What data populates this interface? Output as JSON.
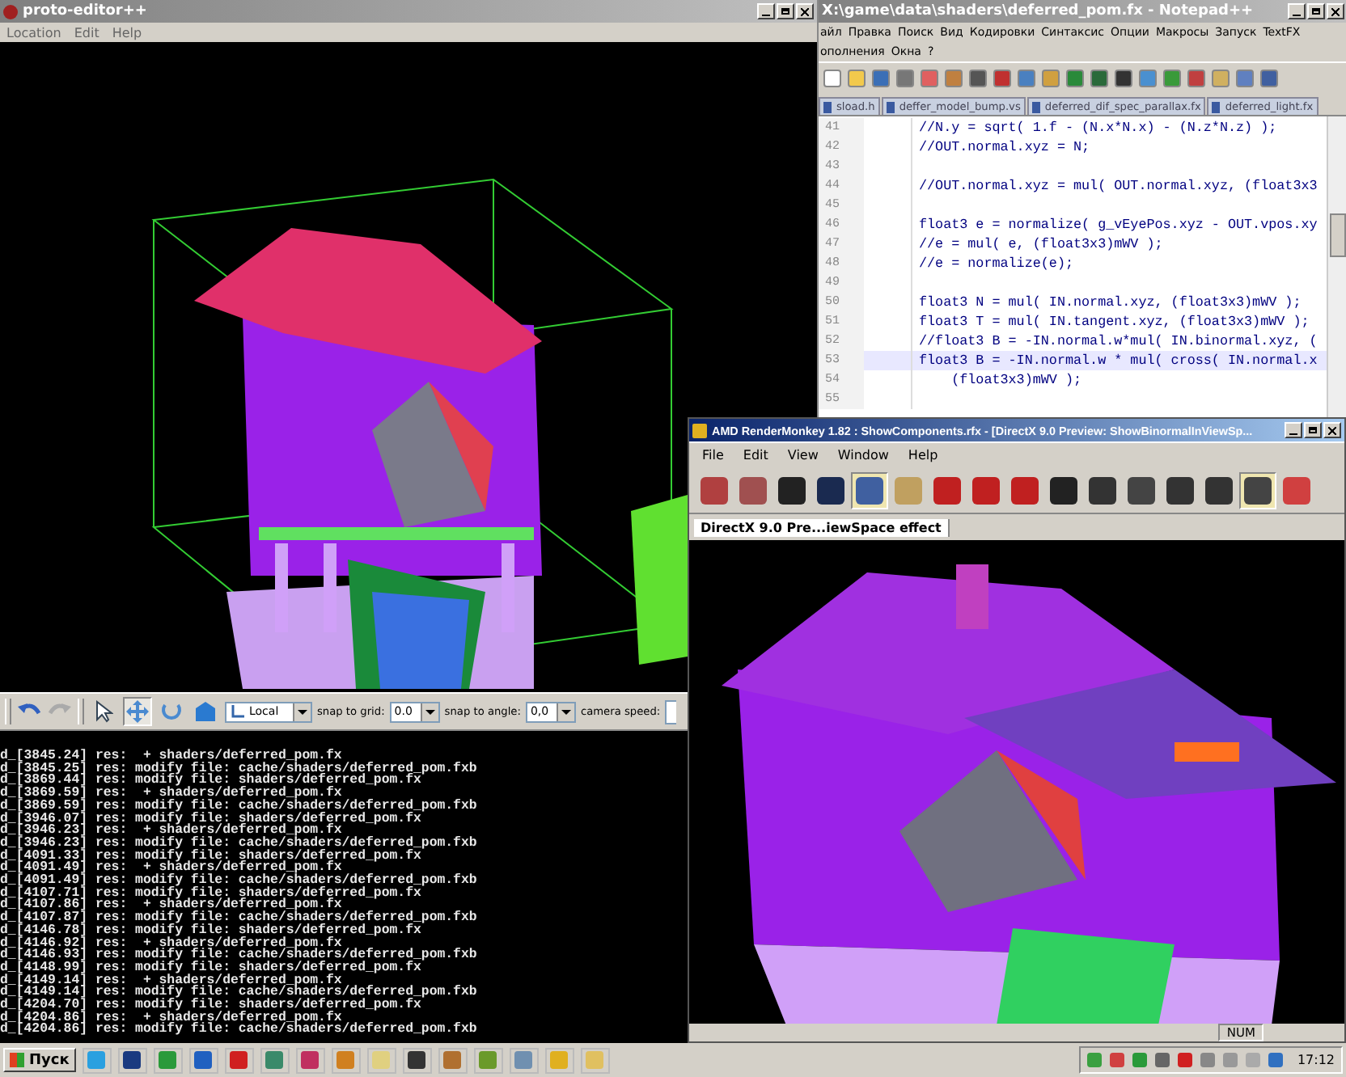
{
  "proto_editor": {
    "title": "proto-editor++",
    "menu": [
      "Location",
      "Edit",
      "Help"
    ],
    "tools": [
      {
        "kind": "select",
        "selected": false
      },
      {
        "kind": "move",
        "selected": true
      },
      {
        "kind": "rotate",
        "selected": false
      },
      {
        "kind": "scale",
        "selected": false
      }
    ],
    "toolbar": {
      "space": "Local",
      "grid_label": "snap to grid:",
      "grid": "0.0",
      "angle_label": "snap to angle:",
      "angle": "0,0",
      "speed_label": "camera speed:"
    },
    "log": [
      "d_[3845.24] res:  + shaders/deferred_pom.fx",
      "d_[3845.25] res: modify file: cache/shaders/deferred_pom.fxb",
      "d_[3869.44] res: modify file: shaders/deferred_pom.fx",
      "d_[3869.59] res:  + shaders/deferred_pom.fx",
      "d_[3869.59] res: modify file: cache/shaders/deferred_pom.fxb",
      "d_[3946.07] res: modify file: shaders/deferred_pom.fx",
      "d_[3946.23] res:  + shaders/deferred_pom.fx",
      "d_[3946.23] res: modify file: cache/shaders/deferred_pom.fxb",
      "d_[4091.33] res: modify file: shaders/deferred_pom.fx",
      "d_[4091.49] res:  + shaders/deferred_pom.fx",
      "d_[4091.49] res: modify file: cache/shaders/deferred_pom.fxb",
      "d_[4107.71] res: modify file: shaders/deferred_pom.fx",
      "d_[4107.86] res:  + shaders/deferred_pom.fx",
      "d_[4107.87] res: modify file: cache/shaders/deferred_pom.fxb",
      "d_[4146.78] res: modify file: shaders/deferred_pom.fx",
      "d_[4146.92] res:  + shaders/deferred_pom.fx",
      "d_[4146.93] res: modify file: cache/shaders/deferred_pom.fxb",
      "d_[4148.99] res: modify file: shaders/deferred_pom.fx",
      "d_[4149.14] res:  + shaders/deferred_pom.fx",
      "d_[4149.14] res: modify file: cache/shaders/deferred_pom.fxb",
      "d_[4204.70] res: modify file: shaders/deferred_pom.fx",
      "d_[4204.86] res:  + shaders/deferred_pom.fx",
      "d_[4204.86] res: modify file: cache/shaders/deferred_pom.fxb"
    ]
  },
  "notepad": {
    "title": "X:\\game\\data\\shaders\\deferred_pom.fx - Notepad++",
    "menu": [
      "айл",
      "Правка",
      "Поиск",
      "Вид",
      "Кодировки",
      "Синтаксис",
      "Опции",
      "Макросы",
      "Запуск",
      "TextFX"
    ],
    "menu_row2": [
      "ополнения",
      "Окна",
      "?"
    ],
    "tabs": [
      {
        "label": "sload.h",
        "selected": false
      },
      {
        "label": "deffer_model_bump.vs",
        "selected": false
      },
      {
        "label": "deferred_dif_spec_parallax.fx",
        "selected": false
      },
      {
        "label": "deferred_light.fx",
        "selected": false
      }
    ],
    "lines": [
      {
        "number": "41",
        "code": "//N.y = sqrt( 1.f - (N.x*N.x) - (N.z*N.z) );",
        "current": false
      },
      {
        "number": "42",
        "code": "//OUT.normal.xyz = N;",
        "current": false
      },
      {
        "number": "43",
        "current": false
      },
      {
        "number": "44",
        "code": "//OUT.normal.xyz = mul( OUT.normal.xyz, (float3x3",
        "current": false
      },
      {
        "number": "45",
        "current": false
      },
      {
        "number": "46",
        "code": "float3 e = normalize( g_vEyePos.xyz - OUT.vpos.xy",
        "current": false
      },
      {
        "number": "47",
        "code": "//e = mul( e, (float3x3)mWV );",
        "current": false
      },
      {
        "number": "48",
        "code": "//e = normalize(e);",
        "current": false
      },
      {
        "number": "49",
        "current": false
      },
      {
        "number": "50",
        "code": "float3 N = mul( IN.normal.xyz, (float3x3)mWV );",
        "current": false
      },
      {
        "number": "51",
        "code": "float3 T = mul( IN.tangent.xyz, (float3x3)mWV );",
        "current": false
      },
      {
        "number": "52",
        "code": "//float3 B = -IN.normal.w*mul( IN.binormal.xyz, (",
        "current": false
      },
      {
        "number": "53",
        "code": "float3 B = -IN.normal.w * mul( cross( IN.normal.x",
        "current": true
      },
      {
        "number": "54",
        "code": "    (float3x3)mWV );",
        "current": false
      },
      {
        "number": "55",
        "current": false
      }
    ]
  },
  "render_monkey": {
    "title": "AMD RenderMonkey 1.82 : ShowComponents.rfx - [DirectX 9.0 Preview: ShowBinormalInViewSp...",
    "menu": [
      "File",
      "Edit",
      "View",
      "Window",
      "Help"
    ],
    "toolbar": [
      {
        "pressed": false
      },
      {
        "pressed": false
      },
      {
        "pressed": false
      },
      {
        "pressed": false
      },
      {
        "pressed": true
      },
      {
        "pressed": false
      },
      {
        "pressed": false
      },
      {
        "pressed": false
      },
      {
        "pressed": false
      },
      {
        "pressed": false
      },
      {
        "pressed": false
      },
      {
        "pressed": false
      },
      {
        "pressed": false
      },
      {
        "pressed": false
      },
      {
        "pressed": true
      },
      {
        "pressed": false
      }
    ],
    "document_tab": "DirectX 9.0 Pre...iewSpace effect",
    "status": "NUM"
  },
  "taskbar": {
    "start": "Пуск",
    "clock": "17:12"
  }
}
